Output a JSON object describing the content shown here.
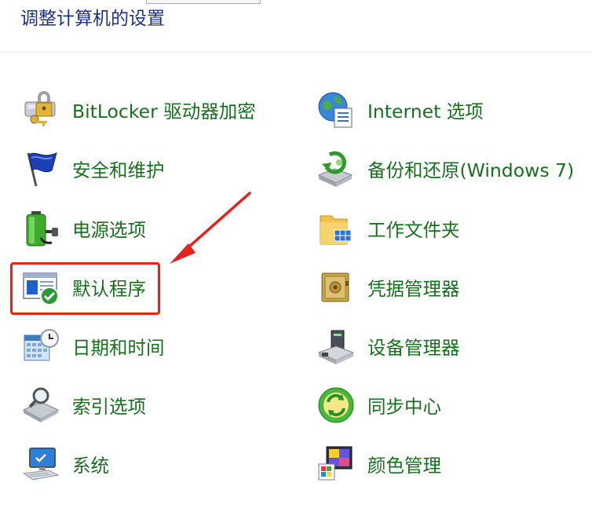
{
  "page": {
    "title": "调整计算机的设置"
  },
  "items": [
    {
      "label": "BitLocker 驱动器加密",
      "icon": "bitlocker-icon"
    },
    {
      "label": "Internet 选项",
      "icon": "internet-options-icon"
    },
    {
      "label": "安全和维护",
      "icon": "security-flag-icon"
    },
    {
      "label": "备份和还原(Windows 7)",
      "icon": "backup-restore-icon"
    },
    {
      "label": "电源选项",
      "icon": "power-options-icon"
    },
    {
      "label": "工作文件夹",
      "icon": "work-folders-icon"
    },
    {
      "label": "默认程序",
      "icon": "default-programs-icon"
    },
    {
      "label": "凭据管理器",
      "icon": "credential-manager-icon"
    },
    {
      "label": "日期和时间",
      "icon": "date-time-icon"
    },
    {
      "label": "设备管理器",
      "icon": "device-manager-icon"
    },
    {
      "label": "索引选项",
      "icon": "indexing-options-icon"
    },
    {
      "label": "同步中心",
      "icon": "sync-center-icon"
    },
    {
      "label": "系统",
      "icon": "system-icon"
    },
    {
      "label": "颜色管理",
      "icon": "color-management-icon"
    }
  ],
  "annotation": {
    "highlighted_item": "默认程序",
    "box_color": "#e8211b"
  },
  "colors": {
    "title": "#1e3287",
    "link": "#18701e",
    "divider": "#e3e8f0"
  }
}
